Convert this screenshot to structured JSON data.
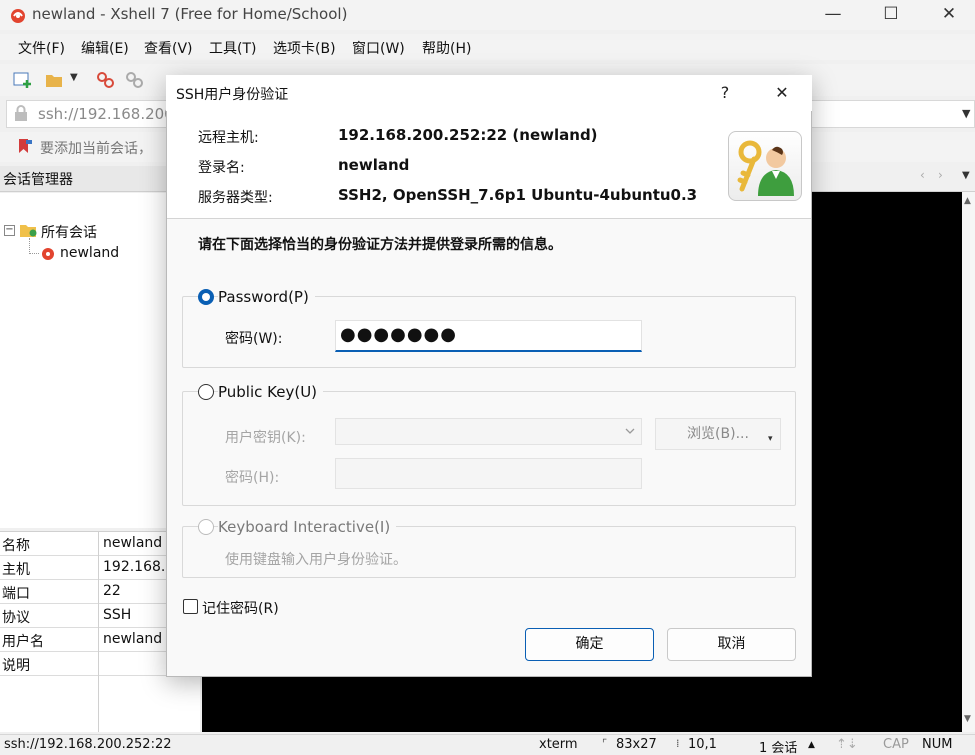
{
  "window": {
    "title": "newland - Xshell 7 (Free for Home/School)",
    "controls": {
      "minimize": "—",
      "maximize": "☐",
      "close": "✕"
    }
  },
  "menu": [
    "文件(F)",
    "编辑(E)",
    "查看(V)",
    "工具(T)",
    "选项卡(B)",
    "窗口(W)",
    "帮助(H)"
  ],
  "address_bar": {
    "value": "ssh://192.168.200"
  },
  "link_bar": {
    "text": "要添加当前会话，"
  },
  "session_manager": {
    "title": "会话管理器",
    "tree": {
      "root": "所有会话",
      "child": "newland"
    }
  },
  "properties": [
    {
      "key": "名称",
      "value": "newland"
    },
    {
      "key": "主机",
      "value": "192.168."
    },
    {
      "key": "端口",
      "value": "22"
    },
    {
      "key": "协议",
      "value": "SSH"
    },
    {
      "key": "用户名",
      "value": "newland"
    },
    {
      "key": "说明",
      "value": ""
    }
  ],
  "status": {
    "connection": "ssh://192.168.200.252:22",
    "terminal": "xterm",
    "size": "83x27",
    "cursor": "10,1",
    "sessions": "1 会话",
    "cap": "CAP",
    "num": "NUM"
  },
  "dialog": {
    "title": "SSH用户身份验证",
    "help": "?",
    "close": "✕",
    "remote_host_label": "远程主机:",
    "remote_host_value": "192.168.200.252:22 (newland)",
    "login_label": "登录名:",
    "login_value": "newland",
    "server_type_label": "服务器类型:",
    "server_type_value": "SSH2, OpenSSH_7.6p1 Ubuntu-4ubuntu0.3",
    "instruction": "请在下面选择恰当的身份验证方法并提供登录所需的信息。",
    "password_option": "Password(P)",
    "password_field_label": "密码(W):",
    "password_value": "●●●●●●●",
    "pubkey_option": "Public Key(U)",
    "user_key_label": "用户密钥(K):",
    "browse_button": "浏览(B)...",
    "passphrase_label": "密码(H):",
    "keyboard_option": "Keyboard Interactive(I)",
    "keyboard_hint": "使用键盘输入用户身份验证。",
    "remember_label": "记住密码(R)",
    "ok_button": "确定",
    "cancel_button": "取消"
  },
  "colors": {
    "accent": "#0a5fb4",
    "terminal_bg": "#000000"
  }
}
